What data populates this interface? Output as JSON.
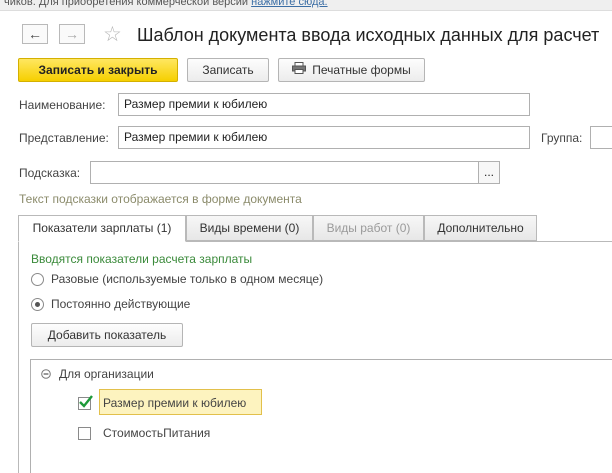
{
  "topbar": {
    "text": "чиков. Для приобретения коммерческой версии ",
    "link": "нажмите сюда."
  },
  "nav": {
    "back_icon": "arrow-left-icon",
    "forward_icon": "arrow-right-icon",
    "favorite_icon": "star-icon"
  },
  "window": {
    "title": "Шаблон документа ввода исходных данных для расчет"
  },
  "toolbar": {
    "save_close": "Записать и закрыть",
    "save": "Записать",
    "print_forms": "Печатные формы",
    "print_icon": "printer-icon"
  },
  "form": {
    "name_label": "Наименование:",
    "name_value": "Размер премии к юбилею",
    "presentation_label": "Представление:",
    "presentation_value": "Размер премии к юбилею",
    "group_label": "Группа:",
    "group_value": "",
    "tooltip_label": "Подсказка:",
    "tooltip_value": "",
    "tooltip_btn": "...",
    "tooltip_hint": "Текст подсказки отображается в форме документа"
  },
  "tabs": [
    {
      "label": "Показатели зарплаты (1)",
      "state": "active"
    },
    {
      "label": "Виды времени (0)",
      "state": "normal"
    },
    {
      "label": "Виды работ (0)",
      "state": "disabled"
    },
    {
      "label": "Дополнительно",
      "state": "normal"
    }
  ],
  "indicators": {
    "heading": "Вводятся показатели расчета зарплаты",
    "radio_one_time": "Разовые (используемые только в одном месяце)",
    "radio_permanent": "Постоянно действующие",
    "selected_radio": "radio_permanent",
    "add_btn": "Добавить показатель"
  },
  "tree": {
    "group_label": "Для организации",
    "collapse_icon": "minus-circle-icon",
    "items": [
      {
        "label": "Размер премии к юбилею",
        "checked": true,
        "selected": true
      },
      {
        "label": "СтоимостьПитания",
        "checked": false,
        "selected": false
      }
    ]
  },
  "colors": {
    "primary_button": "#f6cf00",
    "hint_text": "#8b8b6b",
    "heading_green": "#3a8a3a",
    "check_green": "#1e9a3a",
    "selection": "#fdf3bf"
  }
}
